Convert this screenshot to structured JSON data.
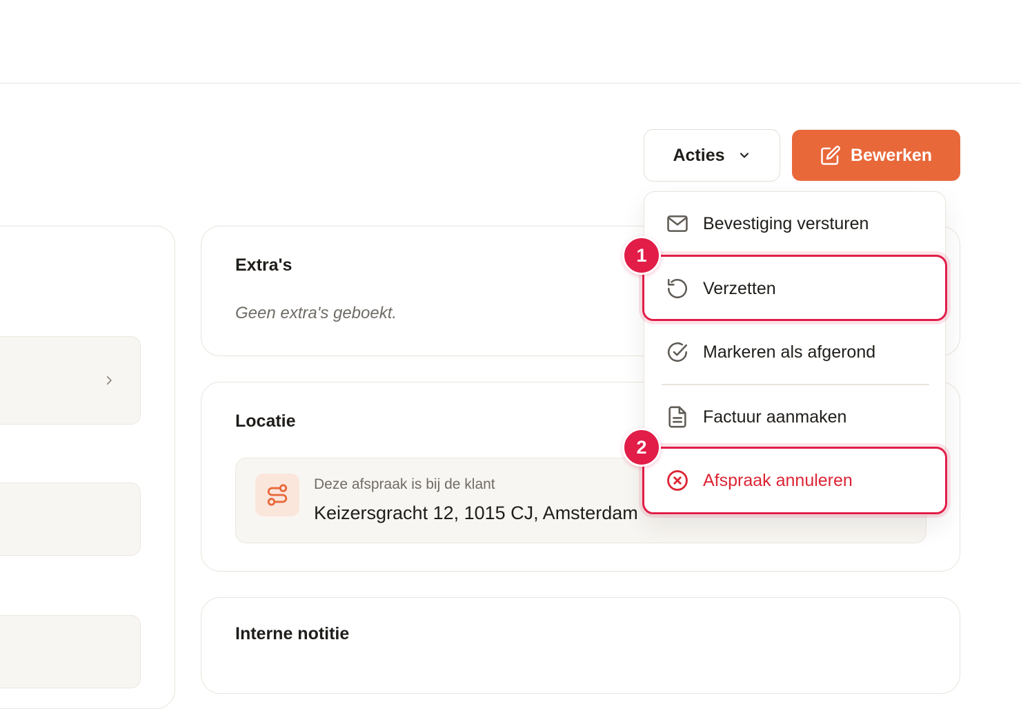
{
  "header": {
    "actions_label": "Acties",
    "edit_label": "Bewerken"
  },
  "extras": {
    "title": "Extra's",
    "empty_text": "Geen extra's geboekt."
  },
  "location": {
    "title": "Locatie",
    "label": "Deze afspraak is bij de klant",
    "address": "Keizersgracht 12, 1015 CJ, Amsterdam"
  },
  "notes": {
    "title": "Interne notitie"
  },
  "menu": {
    "items": [
      {
        "label": "Bevestiging versturen",
        "icon": "mail-icon"
      },
      {
        "label": "Verzetten",
        "icon": "rotate-ccw-icon"
      },
      {
        "label": "Markeren als afgerond",
        "icon": "check-circle-icon"
      },
      {
        "label": "Factuur aanmaken",
        "icon": "file-text-icon"
      },
      {
        "label": "Afspraak annuleren",
        "icon": "x-circle-icon",
        "danger": true
      }
    ]
  },
  "annotations": {
    "badge_1": "1",
    "badge_2": "2"
  },
  "colors": {
    "accent": "#e8683a",
    "danger": "#dc2434",
    "highlight": "#e11d48",
    "surface": "#f8f6f2",
    "border": "#e8e4dc"
  }
}
